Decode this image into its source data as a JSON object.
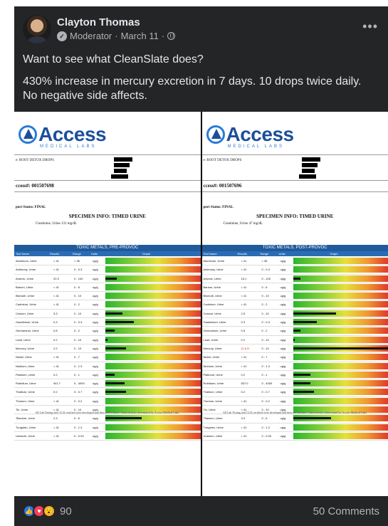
{
  "post": {
    "author": "Clayton Thomas",
    "role": "Moderator",
    "separator1": "·",
    "date": "March 11",
    "separator2": "·",
    "more_icon": "more-options-icon",
    "text_line1": "Want to see what CleanSlate does?",
    "text_line2": "430% increase in mercury excretion in 7 days.  10 drops twice daily. No negative side affects."
  },
  "images": {
    "left": {
      "brand": "Access",
      "brand_sub": "MEDICAL LABS",
      "accession": "ccess#: 001507698",
      "order": "e: ROOT DETOX DROPS",
      "status": "port Status: FINAL",
      "specimen": "SPECIMEN INFO: TIMED URINE",
      "creatinine": "Creatinine, Urine  131 mg/dL",
      "table_title": "TOXIC METALS, PRE-PROVOC",
      "headers": [
        "Test Name",
        "Results",
        "Range",
        "Units",
        "Graph"
      ],
      "rows": [
        {
          "name": "Aluminum, Urine",
          "result": "< 41",
          "range": "< 35",
          "units": "ug/g",
          "level": 0.0
        },
        {
          "name": "Antimony, Urine",
          "result": "< 41",
          "range": "0 - 0.3",
          "units": "ug/g",
          "level": 0.0
        },
        {
          "name": "Arsenic, Urine",
          "result": "22.3",
          "range": "0 - 100",
          "units": "ug/g",
          "level": 0.12
        },
        {
          "name": "Barium, Urine",
          "result": "< 41",
          "range": "0 - 6",
          "units": "ug/g",
          "level": 0.0
        },
        {
          "name": "Bismuth, Urine",
          "result": "< 41",
          "range": "0 - 10",
          "units": "ug/g",
          "level": 0.0
        },
        {
          "name": "Cadmium, Urine",
          "result": "< 41",
          "range": "0 - 2",
          "units": "ug/g",
          "level": 0.0
        },
        {
          "name": "Cesium, Urine",
          "result": "3.3",
          "range": "0 - 10",
          "units": "ug/g",
          "level": 0.18
        },
        {
          "name": "Gadolinium, Urine",
          "result": "0.3",
          "range": "0 - 0.3",
          "units": "ug/g",
          "level": 0.3
        },
        {
          "name": "Germanium, Urine",
          "result": "0.8",
          "range": "0 - 2",
          "units": "ug/g",
          "level": 0.1
        },
        {
          "name": "Lead, Urine",
          "result": "0.2",
          "range": "0 - 10",
          "units": "ug/g",
          "level": 0.02
        },
        {
          "name": "Mercury, Urine",
          "result": "2.2",
          "range": "0 - 10",
          "units": "ug/g",
          "level": 0.22
        },
        {
          "name": "Nickel, Urine",
          "result": "< 41",
          "range": "0 - 7",
          "units": "ug/g",
          "level": 0.0
        },
        {
          "name": "Niobium, Urine",
          "result": "< 41",
          "range": "0 - 1.3",
          "units": "ug/g",
          "level": 0.0
        },
        {
          "name": "Platinum, Urine",
          "result": "0.2",
          "range": "0 - 1",
          "units": "ug/g",
          "level": 0.1
        },
        {
          "name": "Rubidium, Urine",
          "result": "941.7",
          "range": "0 - 4000",
          "units": "ug/g",
          "level": 0.2
        },
        {
          "name": "Thallium, Urine",
          "result": "0.2",
          "range": "0 - 0.7",
          "units": "ug/g",
          "level": 0.22
        },
        {
          "name": "Thorium, Urine",
          "result": "< 41",
          "range": "0 - 0.2",
          "units": "ug/g",
          "level": 0.0
        },
        {
          "name": "Tin, Urine",
          "result": "< 41",
          "range": "0 - 10",
          "units": "ug/g",
          "level": 0.0
        },
        {
          "name": "Titanium, Urine",
          "result": "2.3",
          "range": "0 - 6",
          "units": "ug/g",
          "level": 0.38
        },
        {
          "name": "Tungsten, Urine",
          "result": "< 41",
          "range": "0 - 1.3",
          "units": "ug/g",
          "level": 0.0
        },
        {
          "name": "Uranium, Urine",
          "result": "< 41",
          "range": "0 - 0.03",
          "units": "ug/g",
          "level": 0.0
        }
      ],
      "footer": "All Lab Testing and CLIA certified were developed and their performance characteristics determined by Access Medical Labs."
    },
    "right": {
      "brand": "Access",
      "brand_sub": "MEDICAL LABS",
      "accession": "ccess#: 001507696",
      "order": "e: ROOT DETOX DROPS",
      "status": "port Status: FINAL",
      "specimen": "SPECIMEN INFO: TIMED URINE",
      "creatinine": "Creatinine, Urine  47 mg/dL",
      "table_title": "TOXIC METALS, POST-PROVOC",
      "headers": [
        "Test Name",
        "Results",
        "Range",
        "Units",
        "Graph"
      ],
      "rows": [
        {
          "name": "Aluminum, Urine",
          "result": "< 41",
          "range": "< 35",
          "units": "ug/g",
          "level": 0.0
        },
        {
          "name": "Antimony, Urine",
          "result": "< 41",
          "range": "0 - 0.3",
          "units": "ug/g",
          "level": 0.0
        },
        {
          "name": "Arsenic, Urine",
          "result": "15.1",
          "range": "0 - 100",
          "units": "ug/g",
          "level": 0.08
        },
        {
          "name": "Barium, Urine",
          "result": "< 41",
          "range": "0 - 6",
          "units": "ug/g",
          "level": 0.0
        },
        {
          "name": "Bismuth, Urine",
          "result": "< 41",
          "range": "0 - 10",
          "units": "ug/g",
          "level": 0.0
        },
        {
          "name": "Cadmium, Urine",
          "result": "< 41",
          "range": "0 - 2",
          "units": "ug/g",
          "level": 0.0
        },
        {
          "name": "Cesium, Urine",
          "result": "2.5",
          "range": "0 - 10",
          "units": "ug/g",
          "level": 0.45
        },
        {
          "name": "Gadolinium, Urine",
          "result": "0.3",
          "range": "0 - 0.3",
          "units": "ug/g",
          "level": 0.25
        },
        {
          "name": "Germanium, Urine",
          "result": "0.5",
          "range": "0 - 2",
          "units": "ug/g",
          "level": 0.08
        },
        {
          "name": "Lead, Urine",
          "result": "0.2",
          "range": "0 - 10",
          "units": "ug/g",
          "level": 0.02
        },
        {
          "name": "Mercury, Urine",
          "result": "11.6 H",
          "range": "0 - 10",
          "units": "ug/g",
          "level": 1.0
        },
        {
          "name": "Nickel, Urine",
          "result": "< 41",
          "range": "0 - 7",
          "units": "ug/g",
          "level": 0.0
        },
        {
          "name": "Niobium, Urine",
          "result": "< 41",
          "range": "0 - 1.3",
          "units": "ug/g",
          "level": 0.0
        },
        {
          "name": "Platinum, Urine",
          "result": "0.2",
          "range": "0 - 1",
          "units": "ug/g",
          "level": 0.18
        },
        {
          "name": "Rubidium, Urine",
          "result": "837.0",
          "range": "0 - 4000",
          "units": "ug/g",
          "level": 0.18
        },
        {
          "name": "Thallium, Urine",
          "result": "0.2",
          "range": "0 - 0.7",
          "units": "ug/g",
          "level": 0.22
        },
        {
          "name": "Thorium, Urine",
          "result": "< 41",
          "range": "0 - 0.2",
          "units": "ug/g",
          "level": 0.0
        },
        {
          "name": "Tin, Urine",
          "result": "< 41",
          "range": "0 - 10",
          "units": "ug/g",
          "level": 0.0
        },
        {
          "name": "Titanium, Urine",
          "result": "3.0",
          "range": "0 - 6",
          "units": "ug/g",
          "level": 0.4
        },
        {
          "name": "Tungsten, Urine",
          "result": "< 41",
          "range": "0 - 1.3",
          "units": "ug/g",
          "level": 0.0
        },
        {
          "name": "Uranium, Urine",
          "result": "< 41",
          "range": "0 - 0.03",
          "units": "ug/g",
          "level": 0.0
        }
      ],
      "footer": "All Lab Testing and CLIA certified were developed and their performance characteristics determined by Access Medical Labs."
    }
  },
  "footer": {
    "reactions": [
      "like-icon",
      "love-icon",
      "wow-icon"
    ],
    "reaction_count": "90",
    "comments": "50 Comments"
  },
  "colors": {
    "card_bg": "#242526",
    "text": "#e4e6eb",
    "muted": "#b0b3b8",
    "brand_blue": "#1c4f9c"
  }
}
